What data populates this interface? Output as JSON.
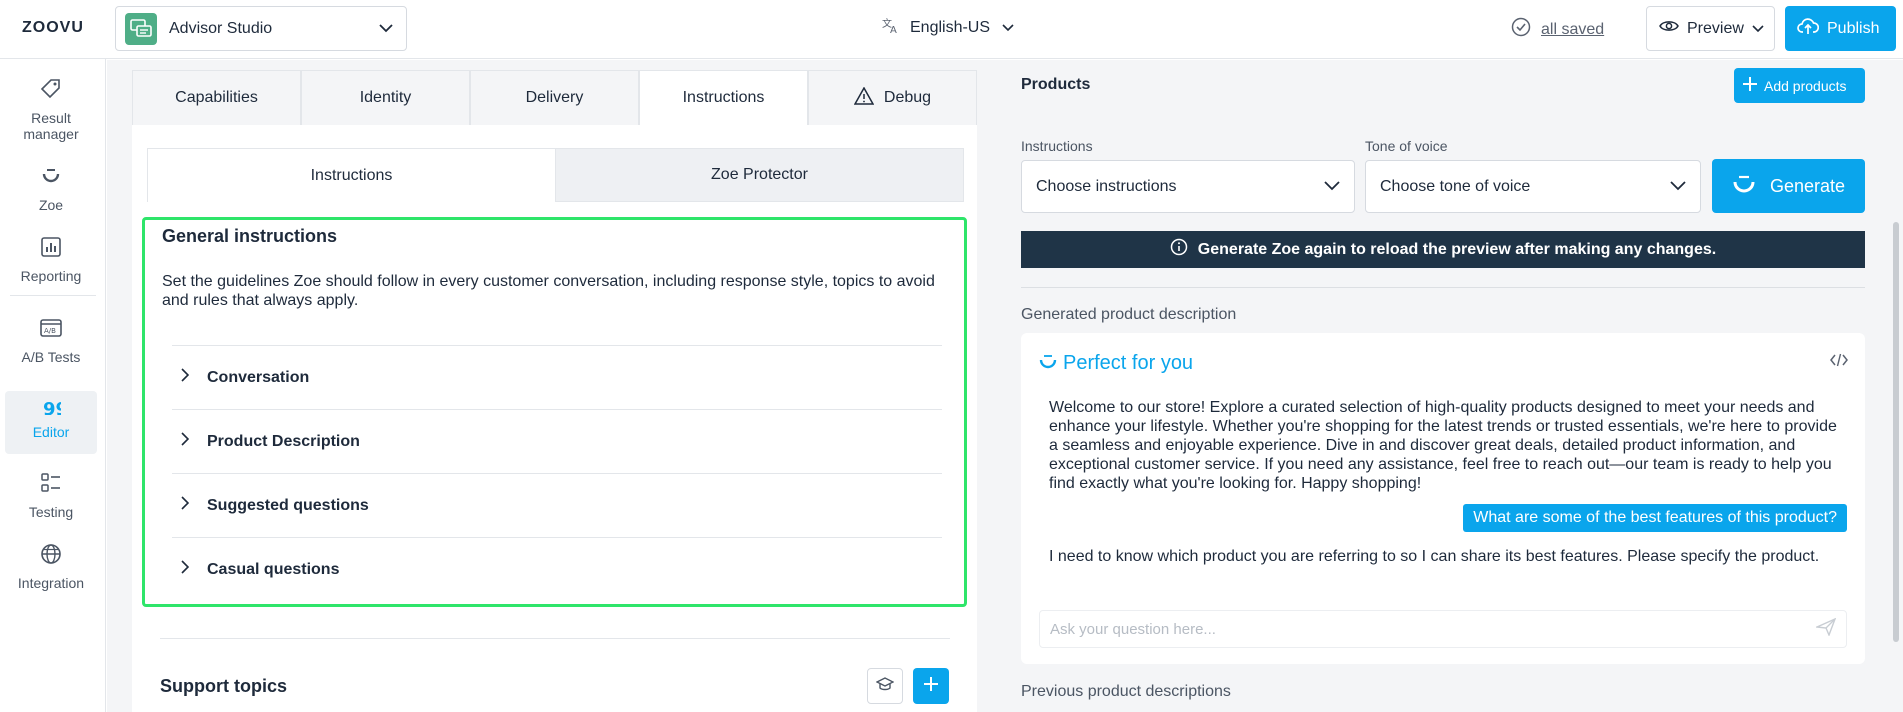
{
  "header": {
    "logo": "ZOOVU",
    "app_name": "Advisor Studio",
    "language": "English-US",
    "saved_status": "all saved",
    "preview_label": "Preview",
    "publish_label": "Publish",
    "accent_color": "#0aa5ec"
  },
  "sidebar": {
    "items": [
      {
        "label": "Result manager",
        "icon": "tag-icon"
      },
      {
        "label": "Zoe",
        "icon": "zoe-smile-icon"
      },
      {
        "label": "Reporting",
        "icon": "bar-chart-icon"
      },
      {
        "label": "A/B Tests",
        "icon": "ab-test-icon"
      },
      {
        "label": "Editor",
        "icon": "quote-icon",
        "active": true
      },
      {
        "label": "Testing",
        "icon": "checklist-icon"
      },
      {
        "label": "Integration",
        "icon": "globe-icon"
      }
    ]
  },
  "tabs": [
    {
      "label": "Capabilities"
    },
    {
      "label": "Identity"
    },
    {
      "label": "Delivery"
    },
    {
      "label": "Instructions",
      "active": true
    },
    {
      "label": "Debug",
      "icon": "warning-icon"
    }
  ],
  "subtabs": [
    {
      "label": "Instructions",
      "active": true
    },
    {
      "label": "Zoe Protector"
    }
  ],
  "general_instructions": {
    "title": "General instructions",
    "description": "Set the guidelines Zoe should follow in every customer conversation, including response style, topics to avoid and rules that always apply.",
    "sections": [
      {
        "label": "Conversation"
      },
      {
        "label": "Product Description"
      },
      {
        "label": "Suggested questions"
      },
      {
        "label": "Casual questions"
      }
    ]
  },
  "support_topics": {
    "title": "Support topics"
  },
  "products_panel": {
    "title": "Products",
    "add_products_label": "Add products",
    "instructions_label": "Instructions",
    "instructions_value": "Choose instructions",
    "tone_label": "Tone of voice",
    "tone_value": "Choose tone of voice",
    "generate_label": "Generate",
    "notice": "Generate Zoe again to reload the preview after making any changes.",
    "generated_label": "Generated product description",
    "preview": {
      "title": "Perfect for you",
      "welcome": "Welcome to our store! Explore a curated selection of high-quality products designed to meet your needs and enhance your lifestyle. Whether you're shopping for the latest trends or trusted essentials, we're here to provide a seamless and enjoyable experience. Dive in and discover great deals, detailed product information, and exceptional customer service. If you need any assistance, feel free to reach out—our team is ready to help you find exactly what you're looking for. Happy shopping!",
      "question": "What are some of the best features of this product?",
      "answer": "I need to know which product you are referring to so I can share its best features. Please specify the product.",
      "ask_placeholder": "Ask your question here..."
    },
    "previous_label": "Previous product descriptions"
  }
}
